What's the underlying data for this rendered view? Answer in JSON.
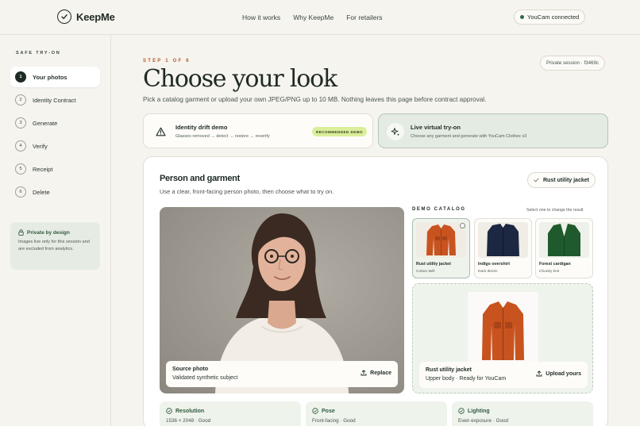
{
  "header": {
    "brand": "KeepMe",
    "nav": [
      "How it works",
      "Why KeepMe",
      "For retailers"
    ],
    "status": "YouCam connected"
  },
  "sidebar": {
    "heading": "SAFE TRY-ON",
    "steps": [
      {
        "num": "1",
        "label": "Your photos"
      },
      {
        "num": "2",
        "label": "Identity Contract"
      },
      {
        "num": "3",
        "label": "Generate"
      },
      {
        "num": "4",
        "label": "Verify"
      },
      {
        "num": "5",
        "label": "Receipt"
      },
      {
        "num": "6",
        "label": "Delete"
      }
    ],
    "active_step": 1,
    "privacy": {
      "title": "Private by design",
      "text": "Images live only for this session and are excluded from analytics."
    }
  },
  "main": {
    "eyebrow": "STEP 1 OF 6",
    "title": "Choose your look",
    "subtitle": "Pick a catalog garment or upload your own JPEG/PNG up to 10 MB. Nothing leaves this page before contract approval.",
    "session": "Private session · f3469c",
    "modes": [
      {
        "title": "Identity drift demo",
        "sub": "Glasses removed → detect → restore → reverify",
        "badge": "RECOMMENDED DEMO"
      },
      {
        "title": "Live virtual try-on",
        "sub": "Choose any garment and generate with YouCam Clothes v3"
      }
    ],
    "panel": {
      "title": "Person and garment",
      "sub": "Use a clear, front-facing person photo, then choose what to try on.",
      "selected": "Rust utility jacket",
      "photo": {
        "title": "Source photo",
        "sub": "Validated synthetic subject",
        "button": "Replace"
      },
      "catalog_heading": "DEMO CATALOG",
      "catalog_hint": "Select one to change the result",
      "items": [
        {
          "name": "Rust utility jacket",
          "sub": "Cotton twill",
          "color": "#c8531f"
        },
        {
          "name": "Indigo overshirt",
          "sub": "Dark denim",
          "color": "#1c2742"
        },
        {
          "name": "Forest cardigan",
          "sub": "Chunky knit",
          "color": "#1f5a2c"
        }
      ],
      "preview": {
        "title": "Rust utility jacket",
        "sub": "Upper body · Ready for YouCam",
        "button": "Upload yours"
      },
      "metrics": [
        {
          "title": "Resolution",
          "sub": "1536 × 2048 · Good"
        },
        {
          "title": "Pose",
          "sub": "Front-facing · Good"
        },
        {
          "title": "Lighting",
          "sub": "Even exposure · Good"
        }
      ]
    }
  },
  "colors": {
    "accent": "#b25a2c",
    "brand_green": "#2f6b45",
    "badge": "#dbee9a"
  }
}
